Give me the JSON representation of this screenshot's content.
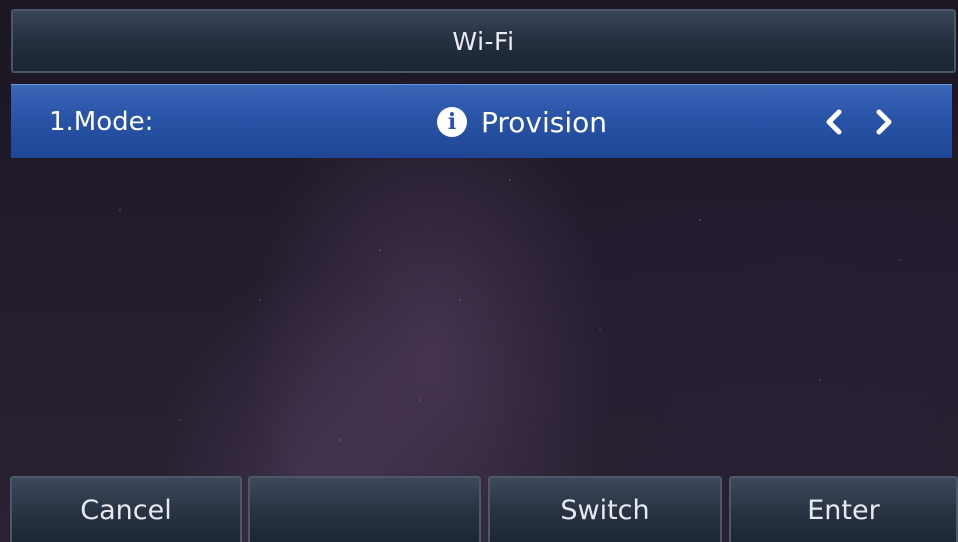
{
  "title_bar": {
    "title": "Wi-Fi"
  },
  "mode_row": {
    "label": "1.Mode:",
    "value": "Provision",
    "value_icon": "info-icon",
    "left_icon": "chevron-left-icon",
    "right_icon": "chevron-right-icon",
    "selected": true
  },
  "softkeys": [
    {
      "label": "Cancel"
    },
    {
      "label": ""
    },
    {
      "label": "Switch"
    },
    {
      "label": "Enter"
    }
  ],
  "colors": {
    "selection_blue": "#2a55a8",
    "title_bar_bg": "#243040",
    "text": "#ffffff"
  }
}
